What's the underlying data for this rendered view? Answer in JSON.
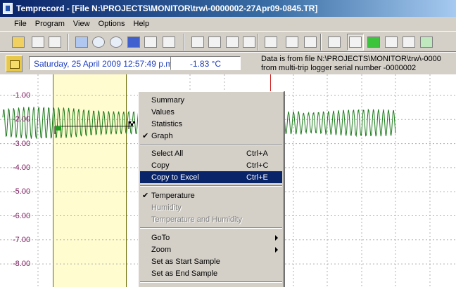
{
  "window": {
    "title": "Temprecord - [File N:\\PROJECTS\\MONITOR\\trw\\-0000002-27Apr09-0845.TR]"
  },
  "menubar": {
    "items": [
      "File",
      "Program",
      "View",
      "Options",
      "Help"
    ]
  },
  "toolbar": {
    "icons": [
      "open-folder-icon",
      "copy-files-icon",
      "print-icon",
      "logger-icon",
      "play-icon",
      "stop-icon",
      "bookmark-icon",
      "undo-icon",
      "settings-gear-icon",
      "graph-tool-1-icon",
      "graph-tool-2-icon",
      "graph-tool-3-icon",
      "graph-tool-4-icon",
      "graph-tool-5-icon",
      "graph-tool-6-icon",
      "graph-tool-7-icon",
      "chart-icon",
      "trip-icon",
      "start-flag-icon",
      "end-flag-icon",
      "copy-icon",
      "excel-icon"
    ]
  },
  "infobar": {
    "date_display": "Saturday, 25 April 2009 12:57:49 p.m.",
    "temperature_display": "-1.83 °C",
    "file_line1": "Data is from file N:\\PROJECTS\\MONITOR\\trw\\-0000",
    "file_line2": "from multi-trip logger serial number -0000002"
  },
  "graph": {
    "y_ticks": [
      "-1.00",
      "-2.00",
      "-3.00",
      "-4.00",
      "-5.00",
      "-6.00",
      "-7.00",
      "-8.00"
    ],
    "line_color": "#1a7a1a",
    "tick_color": "#7a1a5c",
    "highlight_color": "#fffccf"
  },
  "context_menu": {
    "items": [
      {
        "label": "Summary",
        "shortcut": "",
        "checked": false,
        "disabled": false,
        "submenu": false
      },
      {
        "label": "Values",
        "shortcut": "",
        "checked": false,
        "disabled": false,
        "submenu": false
      },
      {
        "label": "Statistics",
        "shortcut": "",
        "checked": false,
        "disabled": false,
        "submenu": false
      },
      {
        "label": "Graph",
        "shortcut": "",
        "checked": true,
        "disabled": false,
        "submenu": false
      },
      {
        "label": "Select All",
        "shortcut": "Ctrl+A",
        "checked": false,
        "disabled": false,
        "submenu": false
      },
      {
        "label": "Copy",
        "shortcut": "Ctrl+C",
        "checked": false,
        "disabled": false,
        "submenu": false
      },
      {
        "label": "Copy to Excel",
        "shortcut": "Ctrl+E",
        "checked": false,
        "disabled": false,
        "submenu": false,
        "selected": true
      },
      {
        "label": "Temperature",
        "shortcut": "",
        "checked": true,
        "disabled": false,
        "submenu": false
      },
      {
        "label": "Humidity",
        "shortcut": "",
        "checked": false,
        "disabled": true,
        "submenu": false
      },
      {
        "label": "Temperature and Humidity",
        "shortcut": "",
        "checked": false,
        "disabled": true,
        "submenu": false
      },
      {
        "label": "GoTo",
        "shortcut": "",
        "checked": false,
        "disabled": false,
        "submenu": true
      },
      {
        "label": "Zoom",
        "shortcut": "",
        "checked": false,
        "disabled": false,
        "submenu": true
      },
      {
        "label": "Set as Start Sample",
        "shortcut": "",
        "checked": false,
        "disabled": false,
        "submenu": false
      },
      {
        "label": "Set as End Sample",
        "shortcut": "",
        "checked": false,
        "disabled": false,
        "submenu": false
      }
    ],
    "check_glyph": "✔"
  }
}
